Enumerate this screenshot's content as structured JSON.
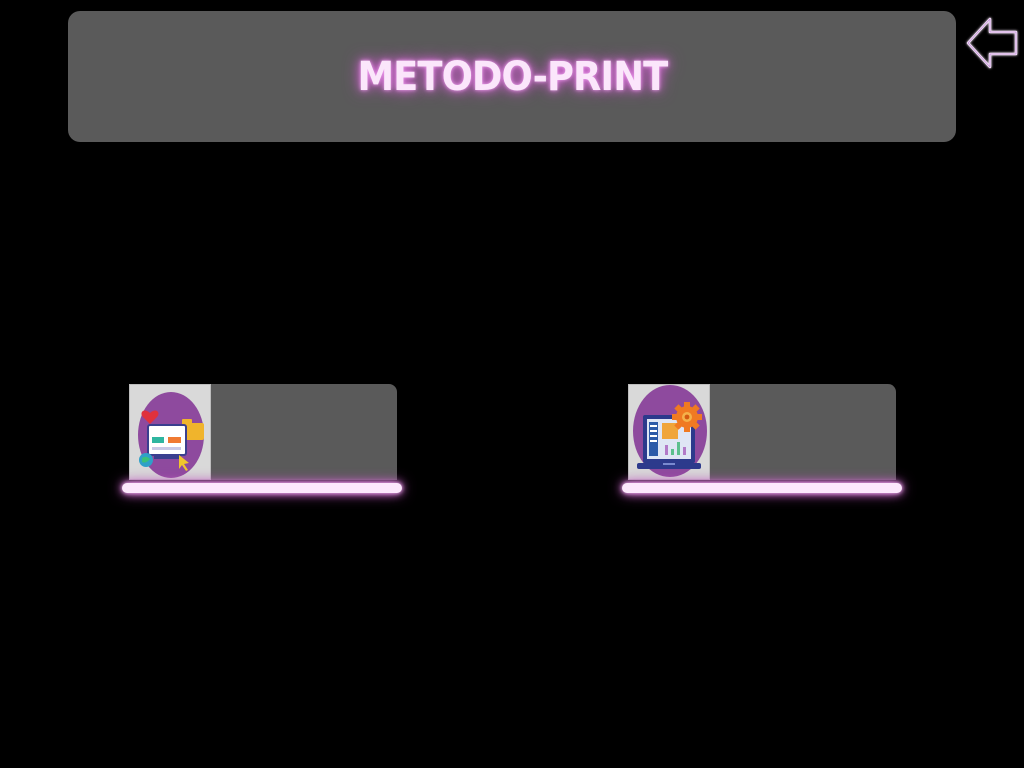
{
  "header": {
    "title": "METODO-PRINT"
  },
  "navigation": {
    "back_icon": "arrow-left-icon"
  },
  "options": [
    {
      "icon": "web-design-icon"
    },
    {
      "icon": "laptop-settings-icon"
    }
  ],
  "colors": {
    "background": "#000000",
    "panel": "#5a5a5a",
    "glow": "#d86ad8",
    "icon_circle": "#8e4a9e"
  }
}
